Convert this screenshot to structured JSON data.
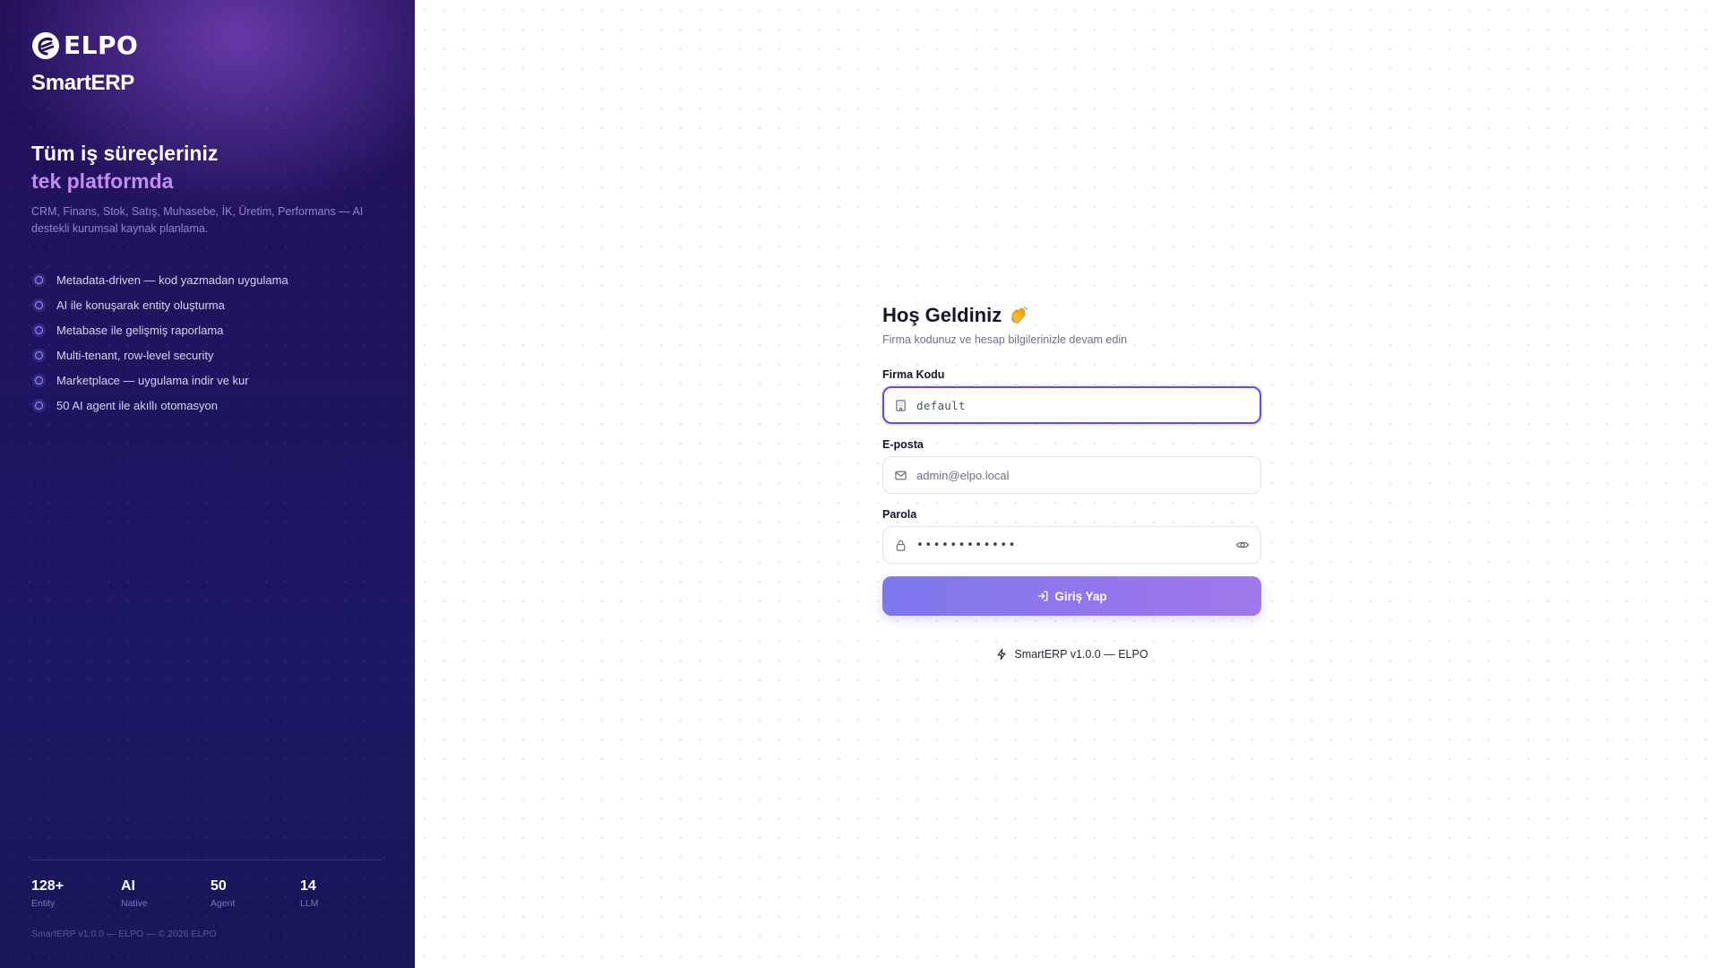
{
  "brand": {
    "logo_text": "ELPO",
    "product_name": "SmartERP",
    "tagline_line1": "Tüm iş süreçleriniz",
    "tagline_line2": "tek platformda",
    "description": "CRM, Finans, Stok, Satış, Muhasebe, İK, Üretim, Performans — AI destekli kurumsal kaynak planlama.",
    "features": [
      "Metadata-driven — kod yazmadan uygulama",
      "AI ile konuşarak entity oluşturma",
      "Metabase ile gelişmiş raporlama",
      "Multi-tenant, row-level security",
      "Marketplace — uygulama indir ve kur",
      "50 AI agent ile akıllı otomasyon"
    ],
    "stats": [
      {
        "value": "128+",
        "label": "Entity"
      },
      {
        "value": "AI",
        "label": "Native"
      },
      {
        "value": "50",
        "label": "Agent"
      },
      {
        "value": "14",
        "label": "LLM"
      }
    ],
    "footer": "SmartERP v1.0.0 — ELPO — © 2026 ELPO"
  },
  "login": {
    "title": "Hoş Geldiniz",
    "title_emoji_icon": "waving-hand-icon",
    "subtitle": "Firma kodunuz ve hesap bilgilerinizle devam edin",
    "company_code": {
      "label": "Firma Kodu",
      "placeholder": "default",
      "icon": "building-icon"
    },
    "email": {
      "label": "E-posta",
      "placeholder": "admin@elpo.local",
      "icon": "mail-icon"
    },
    "password": {
      "label": "Parola",
      "masked_value": "••••••••••••",
      "icon": "lock-icon",
      "toggle_icon": "eye-icon"
    },
    "submit_label": "Giriş Yap",
    "submit_icon": "log-in-icon",
    "version": "SmartERP v1.0.0 — ELPO",
    "version_icon": "bolt-icon"
  },
  "colors": {
    "panel_bg": "#1f145f",
    "accent": "#5b4fe0",
    "tagline_highlight": "#c28cf3",
    "button_start": "#7c78ec",
    "button_end": "#a078ea"
  }
}
